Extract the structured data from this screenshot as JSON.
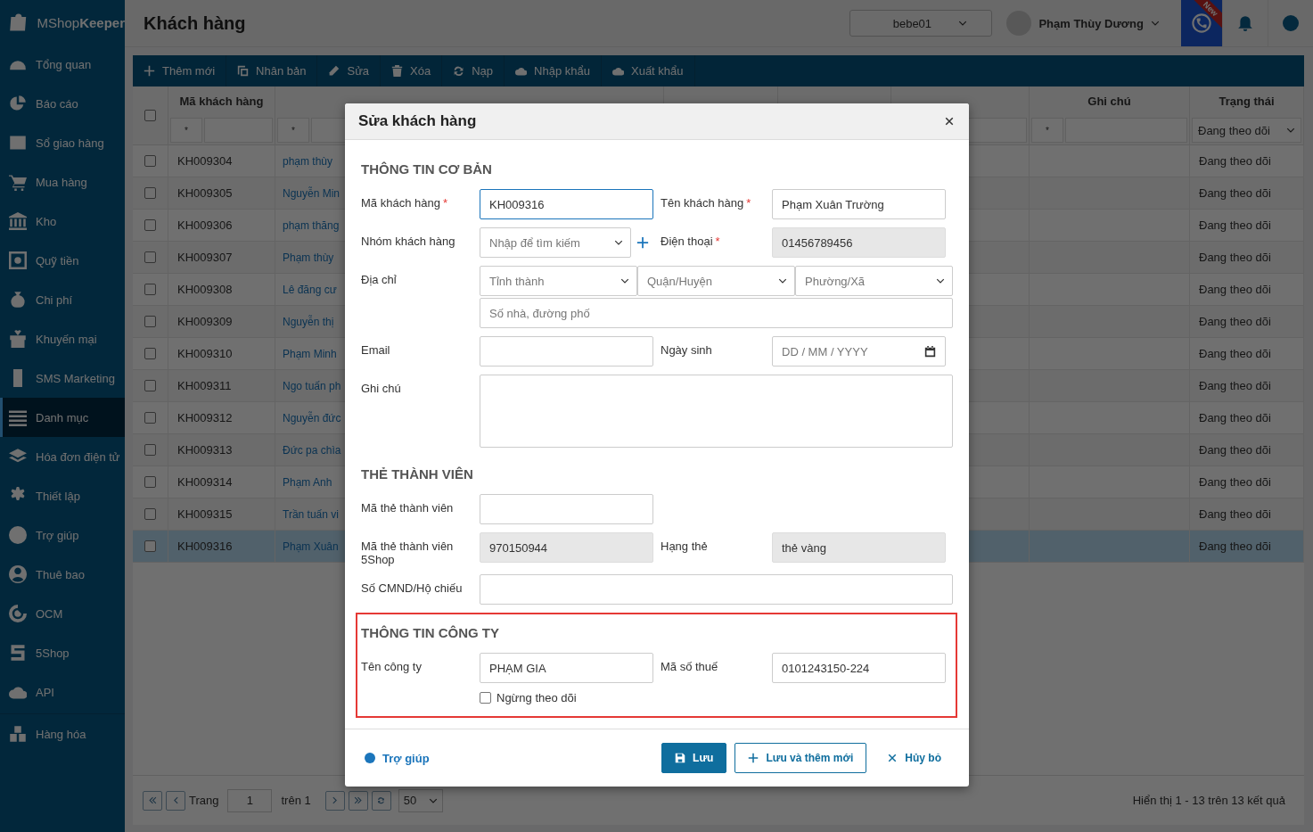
{
  "sidebar": {
    "logo": "MShop**Keeper**",
    "sections": [
      {
        "items": [
          {
            "label": "Tổng quan",
            "selected": false
          },
          {
            "label": "Báo cáo",
            "selected": false
          },
          {
            "label": "Sổ giao hàng",
            "selected": false
          },
          {
            "label": "Mua hàng",
            "selected": false
          },
          {
            "label": "Kho",
            "selected": false
          },
          {
            "label": "Quỹ tiền",
            "selected": false
          },
          {
            "label": "Chi phí",
            "selected": false
          },
          {
            "label": "Khuyến mại",
            "selected": false
          },
          {
            "label": "SMS Marketing",
            "selected": false
          },
          {
            "label": "Danh mục",
            "selected": true
          },
          {
            "label": "Hóa đơn điện tử",
            "selected": false
          },
          {
            "label": "Thiết lập",
            "selected": false
          },
          {
            "label": "Trợ giúp",
            "selected": false
          },
          {
            "label": "Thuê bao",
            "selected": false
          },
          {
            "label": "OCM",
            "selected": false
          },
          {
            "label": "5Shop",
            "selected": false
          },
          {
            "label": "API",
            "selected": false
          }
        ]
      },
      {
        "items": [
          {
            "label": "Hàng hóa",
            "selected": false
          }
        ]
      }
    ]
  },
  "header": {
    "title": "Khách hàng",
    "store_select": "bebe01",
    "user_name": "Phạm Thùy Dương",
    "call_badge": "New"
  },
  "toolbar": [
    "Thêm mới",
    "Nhân bản",
    "Sửa",
    "Xóa",
    "Nạp",
    "Nhập khẩu",
    "Xuất khẩu"
  ],
  "table": {
    "select_all_checked": false,
    "columns": [
      {
        "label": "Mã khách hàng",
        "filter": {
          "kind": "operator",
          "operator": "*"
        }
      },
      {
        "filter": {
          "kind": "operator",
          "operator": "*"
        }
      },
      {},
      {},
      {
        "filter": {
          "kind": "input"
        }
      },
      {
        "label": "Ghi chú",
        "filter": {
          "kind": "operator",
          "operator": "*"
        }
      },
      {
        "label": "Trạng thái",
        "filter": {
          "kind": "select",
          "value": "Đang theo dõi"
        }
      }
    ],
    "rows": [
      {
        "code": "KH009304",
        "name": "phạm thùy",
        "status": "Đang theo dõi",
        "checked": false,
        "selected": false
      },
      {
        "code": "KH009305",
        "name": "Nguyễn Min",
        "status": "Đang theo dõi",
        "checked": false,
        "selected": false
      },
      {
        "code": "KH009306",
        "name": "phạm thăng",
        "status": "Đang theo dõi",
        "checked": false,
        "selected": false
      },
      {
        "code": "KH009307",
        "name": "Phạm thùy",
        "status": "Đang theo dõi",
        "checked": false,
        "selected": false
      },
      {
        "code": "KH009308",
        "name": "Lê đăng cư",
        "status": "Đang theo dõi",
        "checked": false,
        "selected": false
      },
      {
        "code": "KH009309",
        "name": "Nguyễn thị",
        "status": "Đang theo dõi",
        "checked": false,
        "selected": false
      },
      {
        "code": "KH009310",
        "name": "Phạm Minh",
        "status": "Đang theo dõi",
        "checked": false,
        "selected": false
      },
      {
        "code": "KH009311",
        "name": "Ngo tuấn ph",
        "status": "Đang theo dõi",
        "checked": false,
        "selected": false
      },
      {
        "code": "KH009312",
        "name": "Nguyễn đức",
        "status": "Đang theo dõi",
        "checked": false,
        "selected": false
      },
      {
        "code": "KH009313",
        "name": "Đức pa chìa",
        "status": "Đang theo dõi",
        "checked": false,
        "selected": false
      },
      {
        "code": "KH009314",
        "name": "Phạm Anh",
        "status": "Đang theo dõi",
        "checked": false,
        "selected": false
      },
      {
        "code": "KH009315",
        "name": "Trần tuấn vi",
        "status": "Đang theo dõi",
        "checked": false,
        "selected": false
      },
      {
        "code": "KH009316",
        "name": "Phạm Xuân",
        "status": "Đang theo dõi",
        "checked": false,
        "selected": true
      }
    ]
  },
  "pager": {
    "page_label": "Trang",
    "page": "1",
    "of_label": "trên 1",
    "page_size": "50",
    "summary": "Hiển thị 1 - 13 trên 13 kết quả"
  },
  "modal": {
    "title": "Sửa khách hàng",
    "sections": [
      {
        "title": "THÔNG TIN CƠ BẢN",
        "highlighted": false,
        "rows": [
          {
            "fields": [
              {
                "kind": "text",
                "label": "Mã khách hàng",
                "required": true,
                "value": "KH009316",
                "disabled": false,
                "focused": true
              },
              {
                "kind": "text",
                "label": "Tên khách hàng",
                "required": true,
                "value": "Phạm Xuân Trường",
                "disabled": false,
                "focused": false
              }
            ]
          },
          {
            "fields": [
              {
                "kind": "select_add",
                "label": "Nhóm khách hàng",
                "required": false,
                "placeholder": "Nhập để tìm kiếm",
                "disabled": false,
                "focused": false
              },
              {
                "kind": "text",
                "label": "Điện thoại",
                "required": true,
                "value": "01456789456",
                "disabled": true,
                "focused": false
              }
            ]
          },
          {
            "fields": [
              {
                "kind": "address",
                "label": "Địa chỉ",
                "required": false,
                "selects": [
                  "Tỉnh thành",
                  "Quận/Huyện",
                  "Phường/Xã"
                ],
                "street_placeholder": "Số nhà, đường phố",
                "disabled": false,
                "focused": false
              }
            ]
          },
          {
            "fields": [
              {
                "kind": "text",
                "label": "Email",
                "required": false,
                "disabled": false,
                "focused": false
              },
              {
                "kind": "date",
                "label": "Ngày sinh",
                "required": false,
                "placeholder": "DD / MM / YYYY",
                "disabled": false,
                "focused": false
              }
            ]
          },
          {
            "fields": [
              {
                "kind": "textarea",
                "label": "Ghi chú",
                "required": false,
                "disabled": false,
                "focused": false
              }
            ]
          }
        ]
      },
      {
        "title": "THẺ THÀNH VIÊN",
        "highlighted": false,
        "rows": [
          {
            "fields": [
              {
                "kind": "text",
                "label": "Mã thẻ thành viên",
                "required": false,
                "disabled": false,
                "focused": false
              }
            ]
          },
          {
            "fields": [
              {
                "kind": "text",
                "label": "Mã thẻ thành viên 5Shop",
                "required": false,
                "value": "970150944",
                "disabled": true,
                "focused": false
              },
              {
                "kind": "text",
                "label": "Hạng thẻ",
                "required": false,
                "value": "thẻ vàng",
                "disabled": true,
                "focused": false
              }
            ]
          },
          {
            "fields": [
              {
                "kind": "wide",
                "label": "Số CMND/Hộ chiếu",
                "required": false,
                "disabled": false,
                "focused": false
              }
            ]
          }
        ]
      },
      {
        "title": "THÔNG TIN CÔNG TY",
        "highlighted": true,
        "rows": [
          {
            "fields": [
              {
                "kind": "text",
                "label": "Tên công ty",
                "required": false,
                "value": "PHẠM GIA",
                "disabled": false,
                "focused": false
              },
              {
                "kind": "text",
                "label": "Mã số thuế",
                "required": false,
                "value": "0101243150-224",
                "disabled": false,
                "focused": false
              }
            ]
          },
          {
            "fields": [
              {
                "kind": "checkbox",
                "label": "Ngừng theo dõi",
                "checked": false
              }
            ]
          }
        ]
      }
    ],
    "help_link": "Trợ giúp",
    "save_button": "Lưu",
    "save_new_button": "Lưu và thêm mới",
    "cancel_button": "Hủy bỏ"
  }
}
